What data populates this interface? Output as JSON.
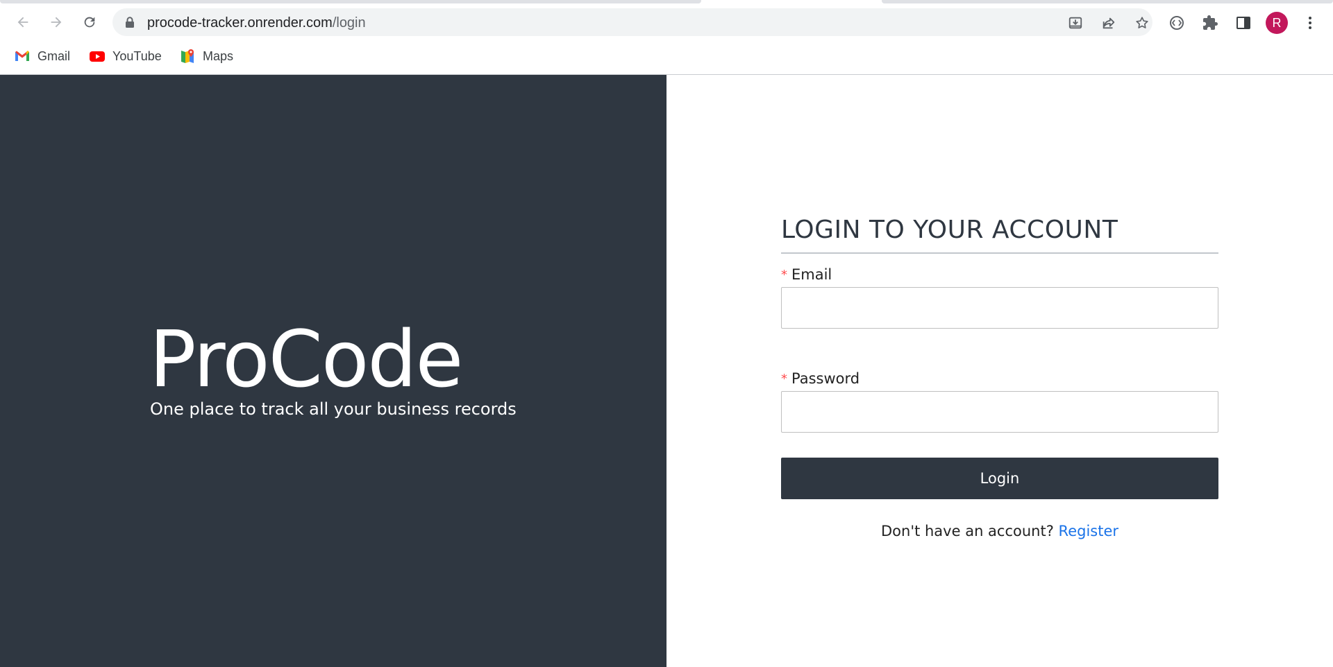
{
  "browser": {
    "url_host": "procode-tracker.onrender.com",
    "url_path": "/login",
    "profile_initial": "R",
    "accent_color": "#c2185b",
    "nav_icons": [
      "back-arrow-icon",
      "forward-arrow-icon",
      "reload-icon"
    ],
    "omnibox_icons": [
      "install-app-icon",
      "share-icon",
      "bookmark-star-icon"
    ],
    "toolbar_icons": [
      "extension-api-icon",
      "puzzle-extensions-icon",
      "side-panel-icon",
      "more-vert-icon"
    ]
  },
  "bookmarks": [
    {
      "label": "Gmail",
      "icon": "gmail-icon"
    },
    {
      "label": "YouTube",
      "icon": "youtube-icon"
    },
    {
      "label": "Maps",
      "icon": "maps-icon"
    }
  ],
  "hero": {
    "brand": "ProCode",
    "tagline": "One place to track all your business records",
    "background_color": "#2f3741"
  },
  "login_form": {
    "title": "LOGIN TO YOUR ACCOUNT",
    "required_marker": "*",
    "email_label": "Email",
    "email_value": "",
    "password_label": "Password",
    "password_value": "",
    "submit_label": "Login",
    "register_prompt": "Don't have an account?",
    "register_link": "Register",
    "link_color": "#1a73e8"
  }
}
